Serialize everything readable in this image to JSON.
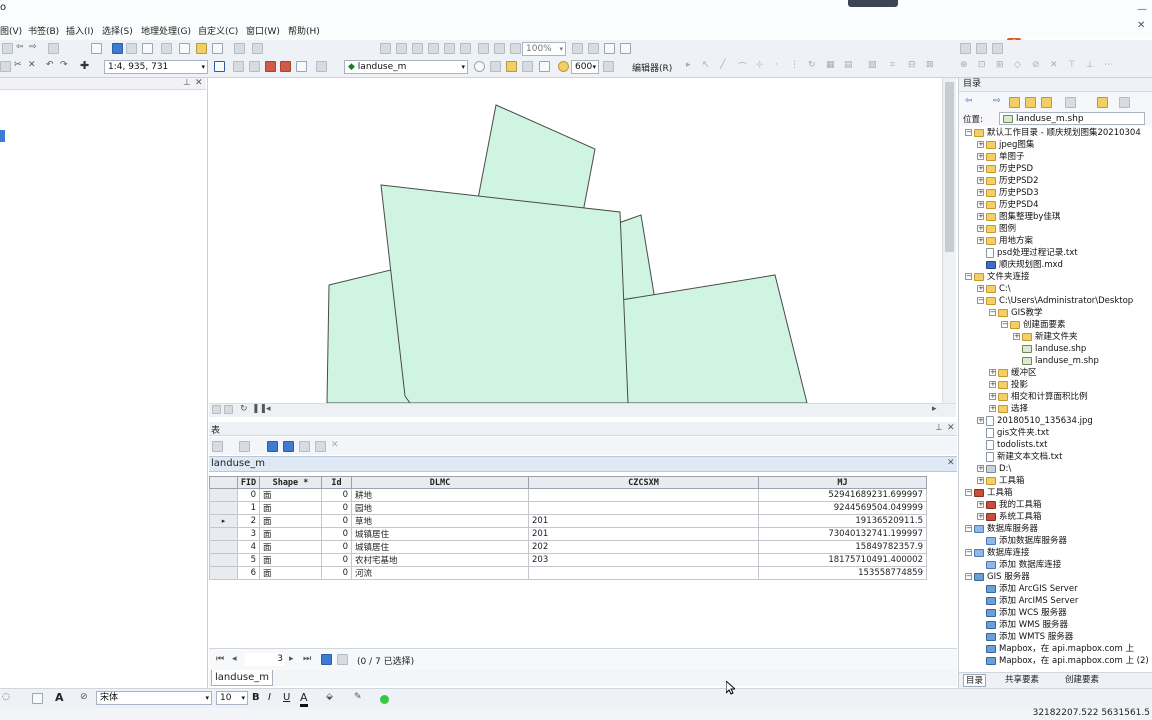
{
  "menubar": {
    "app_fragment": "o",
    "items": [
      "图(V)",
      "书签(B)",
      "插入(I)",
      "选择(S)",
      "地理处理(G)",
      "自定义(C)",
      "窗口(W)",
      "帮助(H)"
    ]
  },
  "toolbar": {
    "scale": "1:4, 935, 731",
    "layer": "landuse_m",
    "opacity": "600",
    "editor": "编辑器(R)",
    "zoom": "100%"
  },
  "table_window": {
    "title": "表",
    "tab": "landuse_m",
    "columns": [
      "FID",
      "Shape *",
      "Id",
      "DLMC",
      "CZCSXM",
      "MJ"
    ],
    "rows": [
      [
        "0",
        "面",
        "0",
        "耕地",
        "",
        "52941689231.699997"
      ],
      [
        "1",
        "面",
        "0",
        "园地",
        "",
        "9244569504.049999"
      ],
      [
        "2",
        "面",
        "0",
        "草地",
        "201",
        "19136520911.5"
      ],
      [
        "3",
        "面",
        "0",
        "城镇居住",
        "201",
        "73040132741.199997"
      ],
      [
        "4",
        "面",
        "0",
        "城镇居住",
        "202",
        "15849782357.9"
      ],
      [
        "5",
        "面",
        "0",
        "农村宅基地",
        "203",
        "18175710491.400002"
      ],
      [
        "6",
        "面",
        "0",
        "河流",
        "",
        "153558774859"
      ]
    ],
    "current_record": "3",
    "selection_status": "(0 / 7 已选择)",
    "bottom_tab": "landuse_m"
  },
  "catalog": {
    "title": "目录",
    "location_label": "位置:",
    "location_value": "landuse_m.shp",
    "tree": [
      {
        "label": "默认工作目录 - 顺庆规划图集20210304",
        "icon": "folder",
        "exp": "−"
      },
      {
        "label": "jpeg图集",
        "icon": "folder",
        "exp": "+"
      },
      {
        "label": "单图子",
        "icon": "folder",
        "exp": "+"
      },
      {
        "label": "历史PSD",
        "icon": "folder",
        "exp": "+"
      },
      {
        "label": "历史PSD2",
        "icon": "folder",
        "exp": "+"
      },
      {
        "label": "历史PSD3",
        "icon": "folder",
        "exp": "+"
      },
      {
        "label": "历史PSD4",
        "icon": "folder",
        "exp": "+"
      },
      {
        "label": "图集整理by佳琪",
        "icon": "folder",
        "exp": "+"
      },
      {
        "label": "图例",
        "icon": "folder",
        "exp": "+"
      },
      {
        "label": "用地方案",
        "icon": "folder",
        "exp": "+"
      },
      {
        "label": "psd处理过程记录.txt",
        "icon": "file",
        "exp": ""
      },
      {
        "label": "顺庆规划图.mxd",
        "icon": "mxd",
        "exp": ""
      },
      {
        "label": "文件夹连接",
        "icon": "folder",
        "exp": "−"
      },
      {
        "label": "C:\\",
        "icon": "folder",
        "exp": "+"
      },
      {
        "label": "C:\\Users\\Administrator\\Desktop",
        "icon": "folder",
        "exp": "−"
      },
      {
        "label": "GIS教学",
        "icon": "folder",
        "exp": "−"
      },
      {
        "label": "创建面要素",
        "icon": "folder",
        "exp": "−"
      },
      {
        "label": "新建文件夹",
        "icon": "folder",
        "exp": "+"
      },
      {
        "label": "landuse.shp",
        "icon": "shp",
        "exp": ""
      },
      {
        "label": "landuse_m.shp",
        "icon": "shp",
        "exp": ""
      },
      {
        "label": "缓冲区",
        "icon": "folder",
        "exp": "+"
      },
      {
        "label": "投影",
        "icon": "folder",
        "exp": "+"
      },
      {
        "label": "相交和计算面积比例",
        "icon": "folder",
        "exp": "+"
      },
      {
        "label": "选择",
        "icon": "folder",
        "exp": "+"
      },
      {
        "label": "20180510_135634.jpg",
        "icon": "file",
        "exp": "+"
      },
      {
        "label": "gis文件夹.txt",
        "icon": "file",
        "exp": ""
      },
      {
        "label": "todolists.txt",
        "icon": "file",
        "exp": ""
      },
      {
        "label": "新建文本文档.txt",
        "icon": "file",
        "exp": ""
      },
      {
        "label": "D:\\",
        "icon": "drive",
        "exp": "+"
      },
      {
        "label": "工具箱",
        "icon": "folder",
        "exp": "+"
      },
      {
        "label": "工具箱",
        "icon": "tool",
        "exp": "−"
      },
      {
        "label": "我的工具箱",
        "icon": "tool",
        "exp": "+"
      },
      {
        "label": "系统工具箱",
        "icon": "tool",
        "exp": "+"
      },
      {
        "label": "数据库服务器",
        "icon": "db",
        "exp": "−"
      },
      {
        "label": "添加数据库服务器",
        "icon": "db",
        "exp": ""
      },
      {
        "label": "数据库连接",
        "icon": "db",
        "exp": "−"
      },
      {
        "label": "添加 数据库连接",
        "icon": "db",
        "exp": ""
      },
      {
        "label": "GIS 服务器",
        "icon": "gis",
        "exp": "−"
      },
      {
        "label": "添加 ArcGIS Server",
        "icon": "gis",
        "exp": ""
      },
      {
        "label": "添加 ArcIMS Server",
        "icon": "gis",
        "exp": ""
      },
      {
        "label": "添加 WCS 服务器",
        "icon": "gis",
        "exp": ""
      },
      {
        "label": "添加 WMS 服务器",
        "icon": "gis",
        "exp": ""
      },
      {
        "label": "添加 WMTS 服务器",
        "icon": "gis",
        "exp": ""
      },
      {
        "label": "Mapbox，在 api.mapbox.com 上",
        "icon": "gis",
        "exp": ""
      },
      {
        "label": "Mapbox，在 api.mapbox.com 上 (2)",
        "icon": "gis",
        "exp": ""
      }
    ],
    "bottom_tabs": [
      "目录",
      "共享要素",
      "创建要素"
    ]
  },
  "drawing": {
    "font": "宋体",
    "size": "10"
  },
  "status": {
    "coords": "32182207.522  5631561.5"
  },
  "colors": {
    "polygon_fill": "#cff5e2",
    "polygon_stroke": "#4a4a4a"
  }
}
